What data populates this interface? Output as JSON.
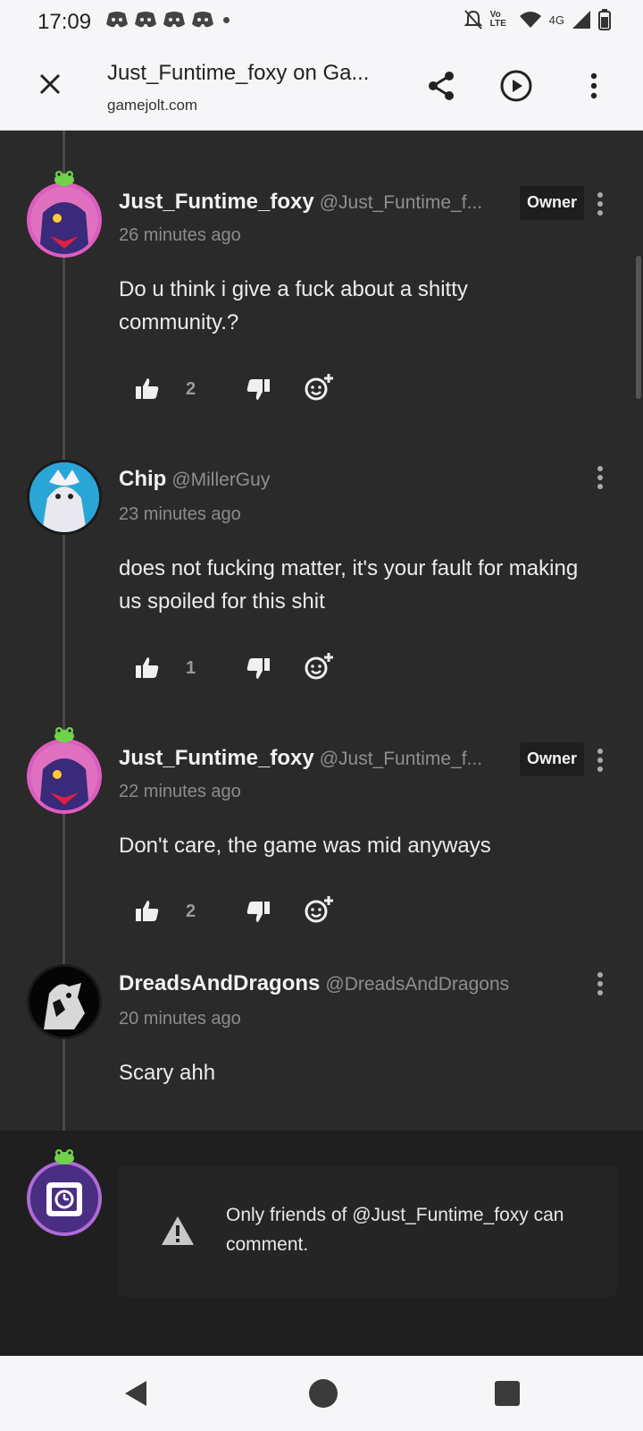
{
  "status_bar": {
    "time": "17:09",
    "network": "4G",
    "volte": "Vo LTE"
  },
  "browser": {
    "title": "Just_Funtime_foxy on Ga...",
    "url": "gamejolt.com"
  },
  "comments": [
    {
      "name": "Just_Funtime_foxy",
      "handle": "@Just_Funtime_f...",
      "badge": "Owner",
      "time": "26 minutes ago",
      "text": "Do u think i give a fuck about a shitty community.?",
      "likes": "2",
      "avatar_color": "#e05cc0"
    },
    {
      "name": "Chip",
      "handle": "@MillerGuy",
      "badge": "",
      "time": "23 minutes ago",
      "text": "does not fucking matter, it's your fault for making us spoiled for this shit",
      "likes": "1",
      "avatar_color": "#2aa6d6"
    },
    {
      "name": "Just_Funtime_foxy",
      "handle": "@Just_Funtime_f...",
      "badge": "Owner",
      "time": "22 minutes ago",
      "text": "Don't care, the game was mid anyways",
      "likes": "2",
      "avatar_color": "#e05cc0"
    },
    {
      "name": "DreadsAndDragons",
      "handle": "@DreadsAndDragons",
      "badge": "",
      "time": "20 minutes ago",
      "text": "Scary ahh",
      "likes": "",
      "avatar_color": "#000000"
    }
  ],
  "composer": {
    "notice": "Only friends of @Just_Funtime_foxy can comment."
  },
  "colors": {
    "background": "#2a2a2a",
    "owner_badge": "#1e1e1e",
    "frog_green": "#6ed34a"
  }
}
